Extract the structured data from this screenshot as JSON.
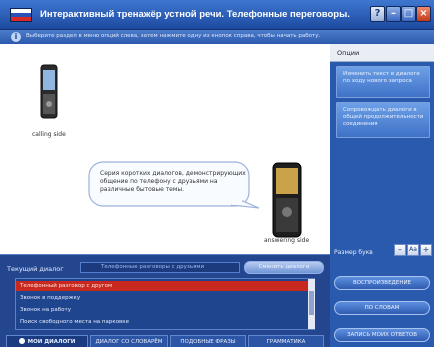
{
  "window": {
    "title": "Интерактивный тренажёр устной речи. Телефонные переговоры.",
    "info_text": "Выберите раздел в меню опций слева, затем нажмите одну из кнопок справа, чтобы начать работу.",
    "buttons": {
      "help": "?",
      "minimize": "–",
      "maximize": "□",
      "close": "×"
    }
  },
  "scene": {
    "calling_label": "calling side",
    "answering_label": "answering side",
    "bubble_text": "Серия коротких диалогов, демонстрирующих общение по телефону с друзьями на различные бытовые темы."
  },
  "options": {
    "title": "Опции",
    "cards": [
      "Изменить текст в диалоге по ходу нового запроса",
      "Сопровождать диалоги в общей продолжительности соединения"
    ],
    "font_size_label": "Размер букв",
    "font_buttons": [
      "–",
      "Aa",
      "+"
    ],
    "buttons": [
      "ВОСПРОИЗВЕДЕНИЕ",
      "ПО СЛОВАМ",
      "ЗАПИСЬ МОИХ ОТВЕТОВ"
    ]
  },
  "dialogs": {
    "current_label": "Текущий диалог",
    "current_value": "Телефонные разговоры с друзьями",
    "current_button": "Сменить диалоги",
    "items": [
      "Телефонный разговор с другом",
      "Звонок в поддержку",
      "Звонок на работу",
      "Поиск свободного места на парковке"
    ],
    "selected_index": 0,
    "tabs": [
      "МОИ ДИАЛОГИ",
      "ДИАЛОГ СО СЛОВАРЁМ",
      "ПОДОБНЫЕ ФРАЗЫ",
      "ГРАММАТИКА"
    ]
  },
  "colors": {
    "accent": "#2a5aad",
    "selected": "#c8281e"
  }
}
